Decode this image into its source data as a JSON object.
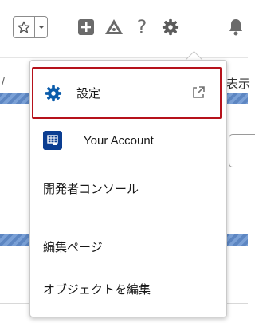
{
  "header": {
    "favorites_icon": "star-icon",
    "favorites_menu_icon": "caret-down-icon",
    "icons": [
      "add-icon",
      "trailhead-icon",
      "help-icon",
      "setup-gear-icon",
      "notifications-bell-icon"
    ],
    "help_glyph": "?"
  },
  "background": {
    "right_text": "表示",
    "slash": "/"
  },
  "menu": {
    "setup_label": "設定",
    "account_label": "Your Account",
    "dev_console_label": "開発者コンソール",
    "edit_page_label": "編集ページ",
    "edit_object_label": "オブジェクトを編集"
  },
  "colors": {
    "highlight_border": "#b6121b",
    "setup_icon": "#0b5cab",
    "account_icon_bg": "#0b3d91",
    "header_icon": "#6b6b6b"
  }
}
